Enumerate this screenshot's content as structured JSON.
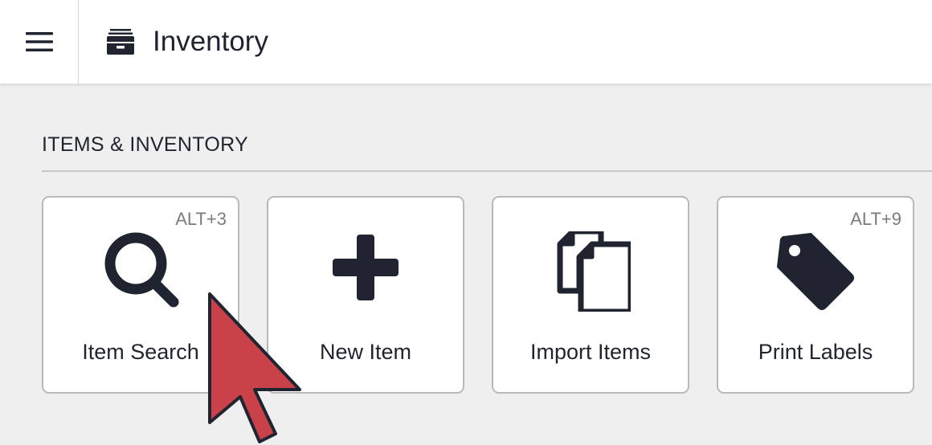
{
  "header": {
    "title": "Inventory",
    "menu_icon": "hamburger-menu-icon",
    "title_icon": "archive-box-icon"
  },
  "section": {
    "title": "ITEMS & INVENTORY"
  },
  "cards": [
    {
      "label": "Item Search",
      "shortcut": "ALT+3",
      "icon": "search-icon"
    },
    {
      "label": "New Item",
      "shortcut": "",
      "icon": "plus-icon"
    },
    {
      "label": "Import Items",
      "shortcut": "",
      "icon": "copy-documents-icon"
    },
    {
      "label": "Print Labels",
      "shortcut": "ALT+9",
      "icon": "tag-icon"
    }
  ],
  "colors": {
    "icon": "#1f2430",
    "background": "#efefef",
    "card_border": "#b9b9b9",
    "cursor": "#c94149"
  }
}
